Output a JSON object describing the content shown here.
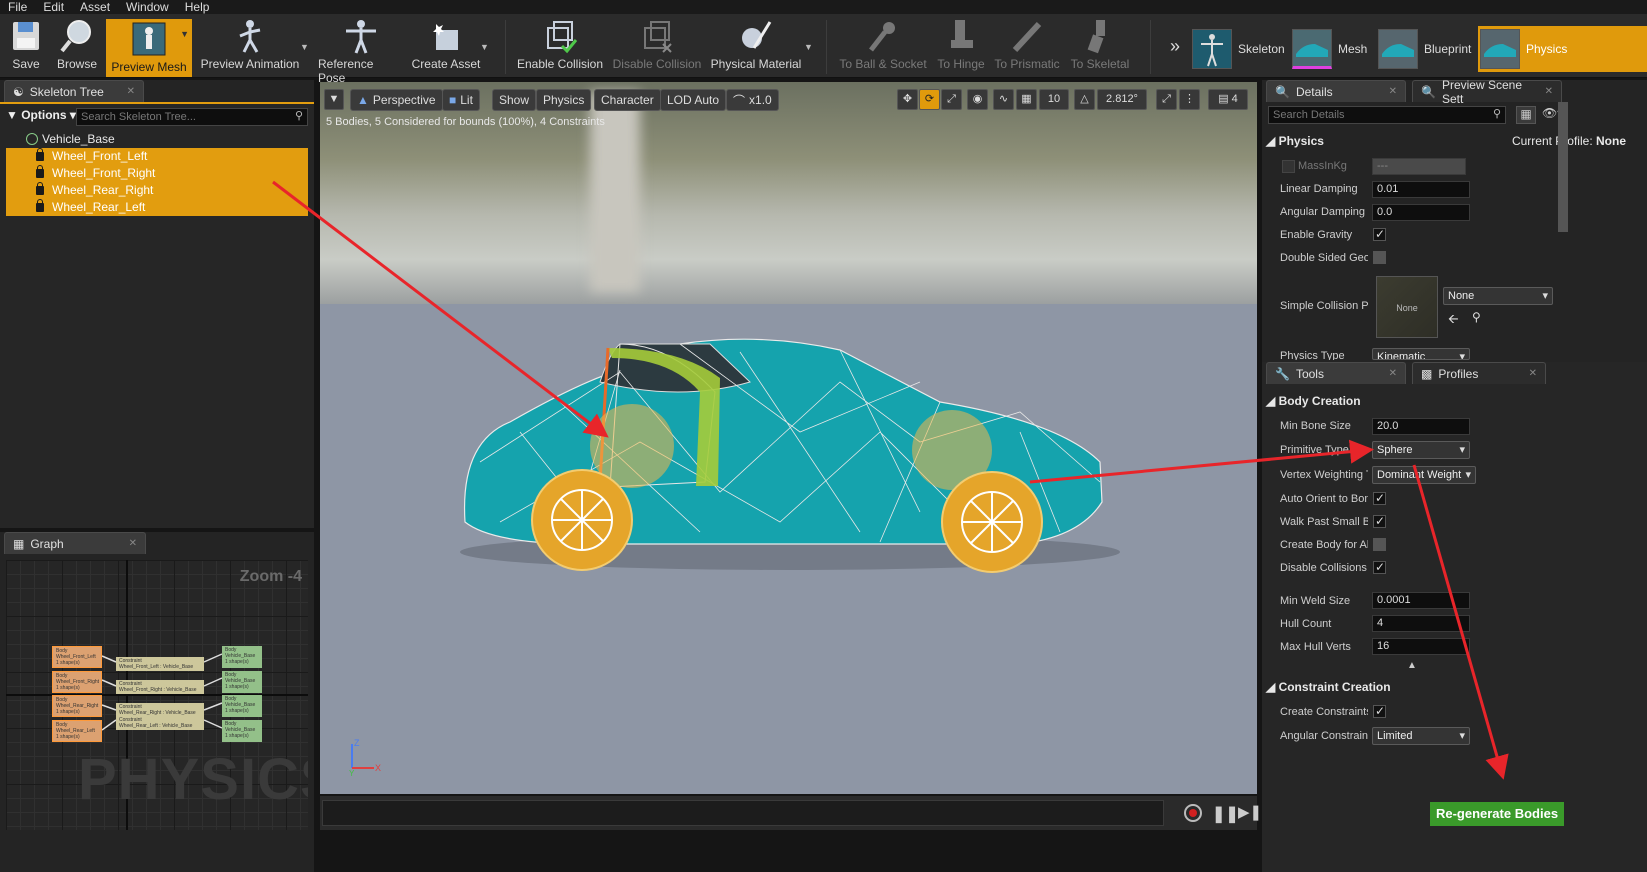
{
  "menu": [
    "File",
    "Edit",
    "Asset",
    "Window",
    "Help"
  ],
  "toolbar": {
    "save": "Save",
    "browse": "Browse",
    "preview_mesh": "Preview Mesh",
    "preview_animation": "Preview Animation",
    "reference_pose": "Reference Pose",
    "create_asset": "Create Asset",
    "enable_collision": "Enable Collision",
    "disable_collision": "Disable Collision",
    "physical_material": "Physical Material",
    "to_ball_socket": "To Ball & Socket",
    "to_hinge": "To Hinge",
    "to_prismatic": "To Prismatic",
    "to_skeletal": "To Skeletal"
  },
  "mode_tabs": {
    "skeleton": "Skeleton",
    "mesh": "Mesh",
    "blueprint": "Blueprint",
    "physics": "Physics"
  },
  "skeleton_tree": {
    "tab": "Skeleton Tree",
    "options": "Options",
    "search_placeholder": "Search Skeleton Tree...",
    "root": "Vehicle_Base",
    "bones": [
      "Wheel_Front_Left",
      "Wheel_Front_Right",
      "Wheel_Rear_Right",
      "Wheel_Rear_Left"
    ]
  },
  "graph": {
    "tab": "Graph",
    "zoom": "Zoom -4",
    "watermark": "PHYSICS",
    "bodies": [
      {
        "l1": "Body",
        "l2": "Wheel_Front_Left",
        "l3": "1 shape(s)"
      },
      {
        "l1": "Body",
        "l2": "Wheel_Front_Right",
        "l3": "1 shape(s)"
      },
      {
        "l1": "Body",
        "l2": "Wheel_Rear_Right",
        "l3": "1 shape(s)"
      },
      {
        "l1": "Body",
        "l2": "Wheel_Rear_Left",
        "l3": "1 shape(s)"
      }
    ],
    "constraints": [
      {
        "l1": "Constraint",
        "l2": "Wheel_Front_Left : Vehicle_Base"
      },
      {
        "l1": "Constraint",
        "l2": "Wheel_Front_Right : Vehicle_Base"
      },
      {
        "l1": "Constraint",
        "l2": "Wheel_Rear_Right : Vehicle_Base"
      },
      {
        "l1": "Constraint",
        "l2": "Wheel_Rear_Left : Vehicle_Base"
      }
    ],
    "base": {
      "l1": "Body",
      "l2": "Vehicle_Base",
      "l3": "1 shape(s)"
    }
  },
  "viewport": {
    "perspective": "Perspective",
    "lit": "Lit",
    "show": "Show",
    "physics": "Physics",
    "character": "Character",
    "lod": "LOD Auto",
    "speed": "x1.0",
    "grid_snap": "10",
    "rot_snap": "2.812°",
    "scale_snap": "4",
    "stats": "5 Bodies, 5 Considered for bounds (100%), 4 Constraints"
  },
  "details": {
    "tab": "Details",
    "tab2": "Preview Scene Sett",
    "search_placeholder": "Search Details",
    "section": "Physics",
    "profile_label": "Current Profile:",
    "profile_value": "None",
    "mass_label": "MassInKg",
    "mass_value": "---",
    "linear_damping_label": "Linear Damping",
    "linear_damping": "0.01",
    "angular_damping_label": "Angular Damping",
    "angular_damping": "0.0",
    "enable_gravity": "Enable Gravity",
    "double_sided": "Double Sided Geom",
    "simple_collision": "Simple Collision P",
    "material_none": "None",
    "material_combo": "None",
    "physics_type_label": "Physics Type",
    "physics_type": "Kinematic"
  },
  "tools": {
    "tab": "Tools",
    "tab2": "Profiles",
    "body_section": "Body Creation",
    "min_bone_label": "Min Bone Size",
    "min_bone": "20.0",
    "primitive_label": "Primitive Type",
    "primitive": "Sphere",
    "vertex_label": "Vertex Weighting T",
    "vertex": "Dominant Weight",
    "auto_orient": "Auto Orient to Bon",
    "walk_past": "Walk Past Small B",
    "create_all": "Create Body for Al",
    "disable_coll": "Disable Collisions",
    "min_weld_label": "Min Weld Size",
    "min_weld": "0.0001",
    "hull_count_label": "Hull Count",
    "hull_count": "4",
    "max_hull_label": "Max Hull Verts",
    "max_hull": "16",
    "constraint_section": "Constraint Creation",
    "create_constraints": "Create Constraints",
    "angular_label": "Angular Constraint",
    "angular": "Limited",
    "regen": "Re-generate Bodies"
  },
  "colors": {
    "accent": "#e29d0f",
    "arrow": "#e8252a",
    "regen": "#3a9a2a"
  }
}
